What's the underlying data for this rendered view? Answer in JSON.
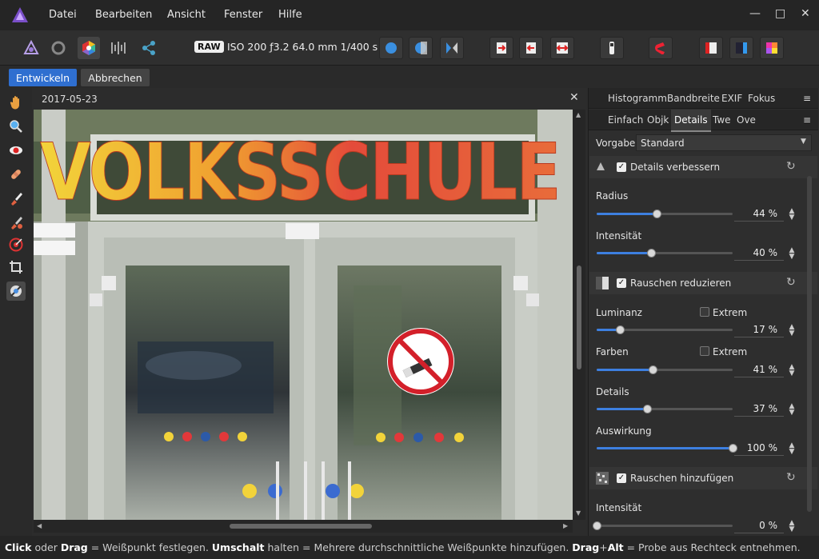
{
  "menu": [
    "Datei",
    "Bearbeiten",
    "Ansicht",
    "Fenster",
    "Hilfe"
  ],
  "toolbar": {
    "raw_badge": "RAW",
    "exif": "ISO 200 ƒ3.2 64.0 mm 1/400 s"
  },
  "context": {
    "develop": "Entwickeln",
    "cancel": "Abbrechen"
  },
  "document": {
    "title": "2017-05-23",
    "sign_text": "VOLKSSCHULE"
  },
  "panel": {
    "top_tabs": [
      "Histogramm",
      "Bandbreite",
      "EXIF",
      "Fokus"
    ],
    "sub_tabs": [
      "Einfach",
      "Objk",
      "Details",
      "Twe",
      "Ove"
    ],
    "preset_label": "Vorgabe:",
    "preset_value": "Standard",
    "sections": {
      "enhance": {
        "title": "Details verbessern",
        "radius_label": "Radius",
        "radius_value": "44 %",
        "radius": 0.44,
        "intensity_label": "Intensität",
        "intensity_value": "40 %",
        "intensity": 0.4
      },
      "noise_reduce": {
        "title": "Rauschen reduzieren",
        "luminance_label": "Luminanz",
        "luminance_value": "17 %",
        "luminance": 0.17,
        "colors_label": "Farben",
        "colors_value": "41 %",
        "colors": 0.41,
        "extreme_label": "Extrem",
        "details_label": "Details",
        "details_value": "37 %",
        "details": 0.37,
        "impact_label": "Auswirkung",
        "impact_value": "100 %",
        "impact": 1.0
      },
      "noise_add": {
        "title": "Rauschen hinzufügen",
        "intensity_label": "Intensität",
        "intensity_value": "0 %",
        "intensity": 0.0
      }
    }
  },
  "status": {
    "p1": "Click",
    "p2": " oder ",
    "p3": "Drag",
    "p4": " = Weißpunkt festlegen. ",
    "p5": "Umschalt",
    "p6": " halten = Mehrere durchschnittliche Weißpunkte hinzufügen. ",
    "p7": "Drag",
    "p8": "+",
    "p9": "Alt",
    "p10": " = Probe aus Rechteck entnehmen."
  },
  "colors": {
    "accent": "#2f6fd0",
    "panel": "#2e2e2e",
    "menubar": "#252525"
  }
}
